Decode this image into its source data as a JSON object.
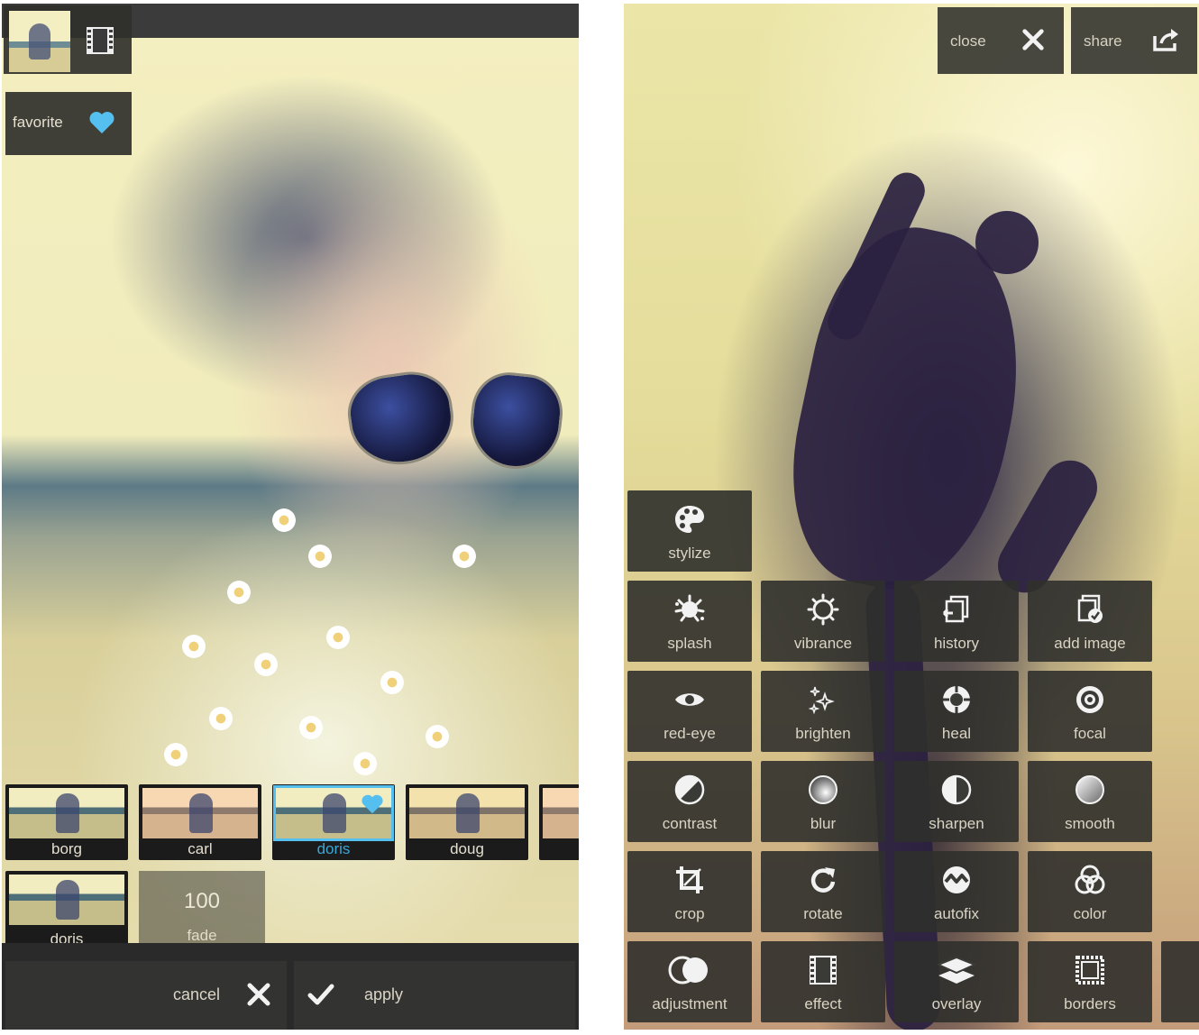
{
  "left_screen": {
    "favorite_label": "favorite",
    "filters": [
      {
        "label": "borg",
        "selected": false
      },
      {
        "label": "carl",
        "selected": false
      },
      {
        "label": "doris",
        "selected": true
      },
      {
        "label": "doug",
        "selected": false
      }
    ],
    "current_filter": {
      "label": "doris"
    },
    "fade": {
      "value": "100",
      "label": "fade"
    },
    "cancel_label": "cancel",
    "apply_label": "apply",
    "accent_color": "#55c0ef"
  },
  "right_screen": {
    "close_label": "close",
    "share_label": "share",
    "tools": {
      "stylize": "stylize",
      "splash": "splash",
      "vibrance": "vibrance",
      "history": "history",
      "add_image": "add image",
      "red_eye": "red-eye",
      "brighten": "brighten",
      "heal": "heal",
      "focal": "focal",
      "contrast": "contrast",
      "blur": "blur",
      "sharpen": "sharpen",
      "smooth": "smooth",
      "crop": "crop",
      "rotate": "rotate",
      "autofix": "autofix",
      "color": "color",
      "adjustment": "adjustment",
      "effect": "effect",
      "overlay": "overlay",
      "borders": "borders"
    }
  }
}
